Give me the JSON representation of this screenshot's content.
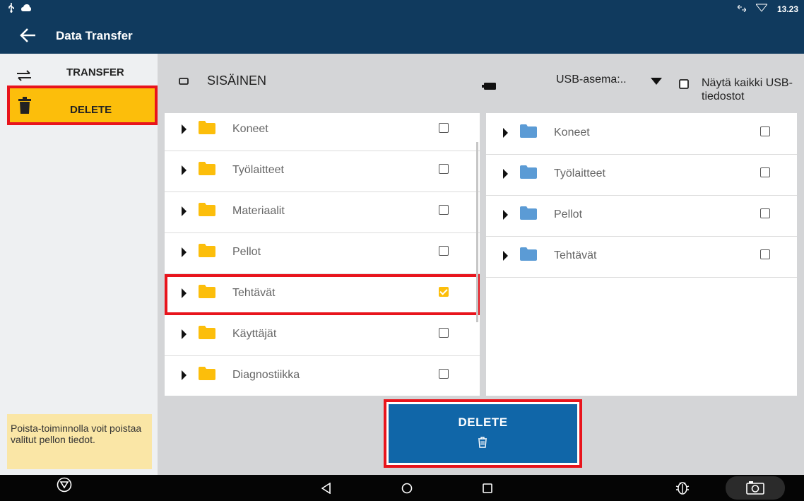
{
  "status": {
    "time": "13.23"
  },
  "appbar": {
    "title": "Data Transfer"
  },
  "sidebar": {
    "items": [
      {
        "label": "TRANSFER"
      },
      {
        "label": "DELETE"
      }
    ],
    "info": "Poista-toiminnolla voit poistaa valitut pellon tiedot."
  },
  "header": {
    "internal_label": "SISÄINEN",
    "usb_select": "USB-asema:..",
    "show_all": "Näytä kaikki USB-tiedostot"
  },
  "internal_folders": [
    {
      "name": "Koneet",
      "checked": false
    },
    {
      "name": "Työlaitteet",
      "checked": false
    },
    {
      "name": "Materiaalit",
      "checked": false
    },
    {
      "name": "Pellot",
      "checked": false
    },
    {
      "name": "Tehtävät",
      "checked": true
    },
    {
      "name": "Käyttäjät",
      "checked": false
    },
    {
      "name": "Diagnostiikka",
      "checked": false
    }
  ],
  "usb_folders": [
    {
      "name": "Koneet",
      "checked": false
    },
    {
      "name": "Työlaitteet",
      "checked": false
    },
    {
      "name": "Pellot",
      "checked": false
    },
    {
      "name": "Tehtävät",
      "checked": false
    }
  ],
  "delete_button": {
    "label": "DELETE"
  },
  "colors": {
    "primary": "#103a5e",
    "accent": "#fcbe0b",
    "button": "#1066a8",
    "highlight": "#e8141c",
    "internal_folder": "#fcbe0b",
    "usb_folder": "#5b9bd5"
  }
}
